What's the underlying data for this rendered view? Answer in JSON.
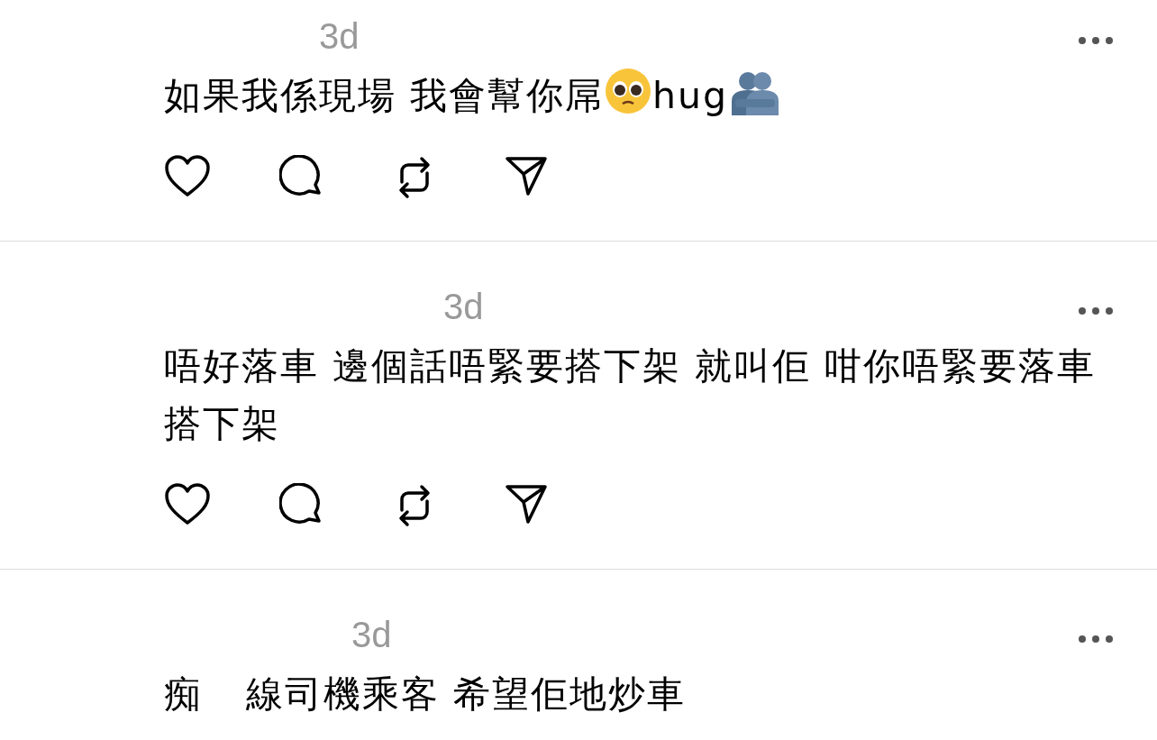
{
  "comments": [
    {
      "time": "3d",
      "segments": [
        {
          "kind": "text",
          "text": "如果我係現場 我會幫你屌"
        },
        {
          "kind": "pleading_face"
        },
        {
          "kind": "text",
          "text": "hug"
        },
        {
          "kind": "hugging_people"
        }
      ],
      "actions": true
    },
    {
      "time": "3d",
      "segments": [
        {
          "kind": "text",
          "text": "唔好落車 邊個話唔緊要搭下架 就叫佢 咁你唔緊要落車搭下架"
        }
      ],
      "actions": true
    },
    {
      "time": "3d",
      "segments": [
        {
          "kind": "text",
          "text": "痴"
        },
        {
          "kind": "gap"
        },
        {
          "kind": "text",
          "text": "線司機乘客 希望佢地炒車"
        }
      ]
    }
  ]
}
